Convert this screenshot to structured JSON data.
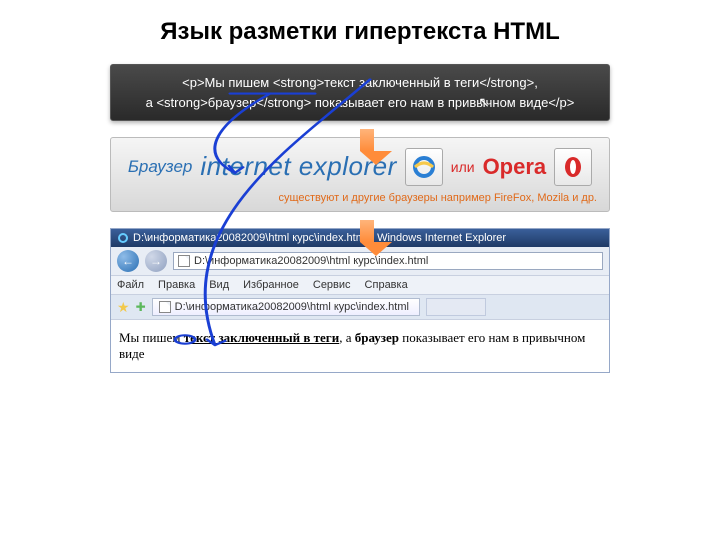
{
  "title": "Язык разметки гипертекста HTML",
  "code_box": {
    "line1": "<p>Мы пишем <strong>текст заключенный в теги</strong>,",
    "line2": "а <strong>браузер</strong> показывает его нам в привычном виде</p>"
  },
  "browser_box": {
    "label": "Браузер",
    "ie": "internet explorer",
    "or": "или",
    "opera": "Opera",
    "note": "существуют и другие браузеры например FireFox, Mozila и др."
  },
  "ie_window": {
    "title": "D:\\информатика20082009\\html курс\\index.html - Windows Internet Explorer",
    "address": "D:\\информатика20082009\\html курс\\index.html",
    "menu": [
      "Файл",
      "Правка",
      "Вид",
      "Избранное",
      "Сервис",
      "Справка"
    ],
    "tab": "D:\\информатика20082009\\html курс\\index.html",
    "content": {
      "p1": "Мы пишем ",
      "strong1": "текст заключенный в теги",
      "p2": ", а ",
      "strong2": "браузер",
      "p3": " показывает его нам в привычном виде"
    }
  }
}
